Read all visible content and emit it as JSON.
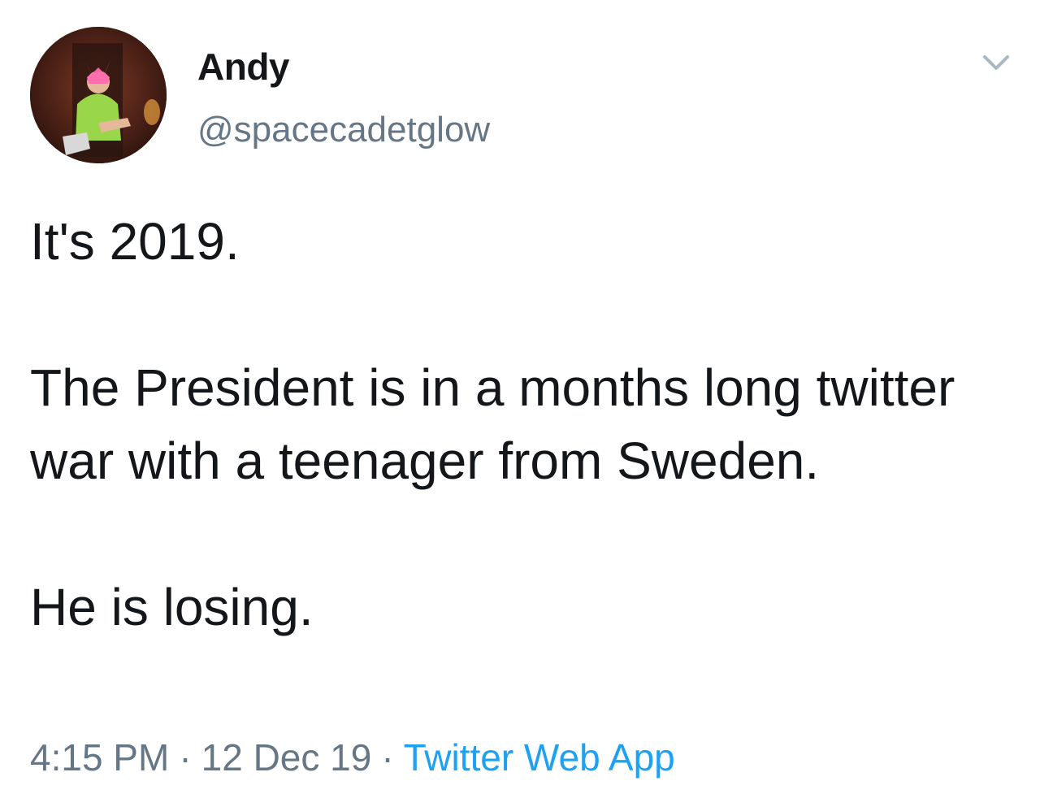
{
  "user": {
    "display_name": "Andy",
    "handle": "@spacecadetglow",
    "avatar_icon": "profile-photo"
  },
  "tweet": {
    "paragraphs": [
      "It's 2019.",
      "The President is in a months long twitter war with a teenager from Sweden.",
      "He is losing."
    ],
    "time": "4:15 PM",
    "separator": "·",
    "date": "12 Dec 19",
    "source": "Twitter Web App"
  },
  "menu": {
    "icon": "chevron-down-icon"
  },
  "colors": {
    "text": "#14171a",
    "secondary": "#657786",
    "link": "#1da1f2",
    "background": "#ffffff"
  }
}
